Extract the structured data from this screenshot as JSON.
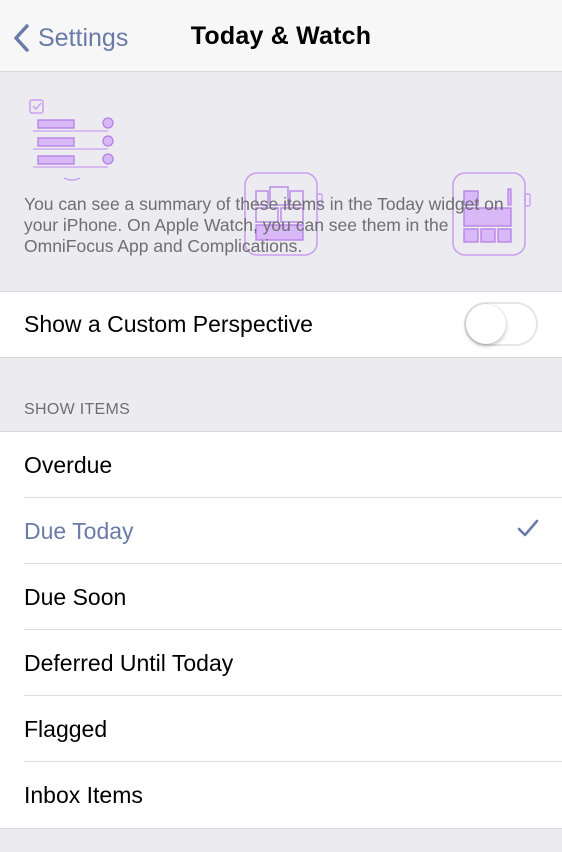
{
  "nav": {
    "back_label": "Settings",
    "title": "Today & Watch"
  },
  "header": {
    "description": "You can see a summary of these items in the Today widget on your iPhone. On Apple Watch, you can see them in the OmniFocus App and Complications."
  },
  "custom_perspective": {
    "label": "Show a Custom Perspective",
    "enabled": false
  },
  "show_items": {
    "section_label": "SHOW ITEMS",
    "items": [
      {
        "label": "Overdue",
        "selected": false
      },
      {
        "label": "Due Today",
        "selected": true
      },
      {
        "label": "Due Soon",
        "selected": false
      },
      {
        "label": "Deferred Until Today",
        "selected": false
      },
      {
        "label": "Flagged",
        "selected": false
      },
      {
        "label": "Inbox Items",
        "selected": false
      }
    ]
  },
  "colors": {
    "accent": "#6b7ba8",
    "illustration": "#c9a0f0"
  }
}
